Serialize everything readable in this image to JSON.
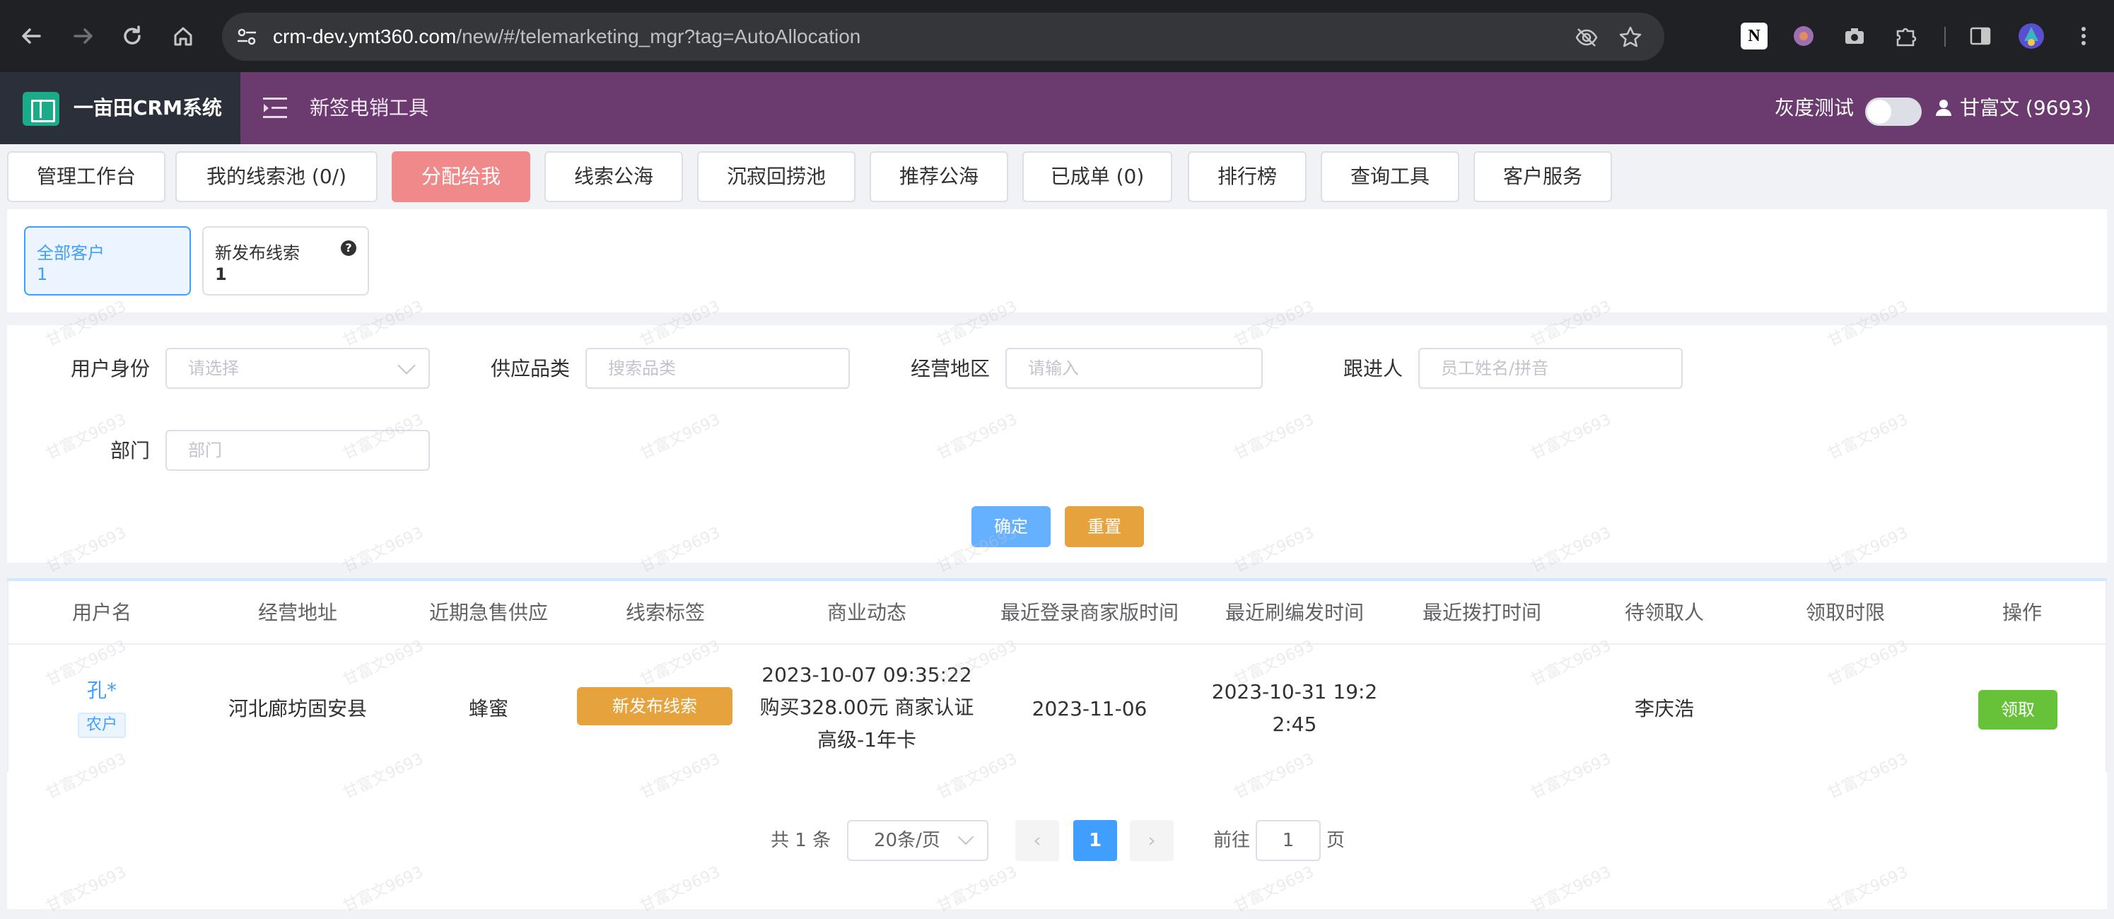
{
  "browser": {
    "url_host": "crm-dev.ymt360.com",
    "url_path": "/new/#/telemarketing_mgr?tag=AutoAllocation",
    "icons": [
      "back-icon",
      "forward-icon",
      "reload-icon",
      "home-icon",
      "site-settings-icon",
      "eye-off-icon",
      "star-icon",
      "notion-icon",
      "extension-icon",
      "camera-icon",
      "puzzle-icon",
      "side-panel-icon",
      "profile-icon",
      "more-icon"
    ]
  },
  "header": {
    "brand": "一亩田CRM系统",
    "tool_title": "新签电销工具",
    "gray_test_label": "灰度测试",
    "gray_test_on": false,
    "user": "甘富文 (9693)",
    "bg_color": "#6b3a6e"
  },
  "tabs": [
    {
      "label": "管理工作台"
    },
    {
      "label": "我的线索池 (0/)"
    },
    {
      "label": "分配给我"
    },
    {
      "label": "线索公海"
    },
    {
      "label": "沉寂回捞池"
    },
    {
      "label": "推荐公海"
    },
    {
      "label": "已成单 (0)"
    },
    {
      "label": "排行榜"
    },
    {
      "label": "查询工具"
    },
    {
      "label": "客户服务"
    }
  ],
  "active_tab": "分配给我",
  "cards": [
    {
      "title": "全部客户",
      "count": "1",
      "active": true
    },
    {
      "title": "新发布线索",
      "count": "1",
      "active": false
    }
  ],
  "filter": {
    "identity_label": "用户身份",
    "identity_placeholder": "请选择",
    "category_label": "供应品类",
    "category_placeholder": "搜索品类",
    "region_label": "经营地区",
    "region_placeholder": "请输入",
    "follower_label": "跟进人",
    "follower_placeholder": "员工姓名/拼音",
    "dept_label": "部门",
    "dept_placeholder": "部门",
    "confirm": "确定",
    "reset": "重置"
  },
  "table": {
    "columns": [
      "用户名",
      "经营地址",
      "近期急售供应",
      "线索标签",
      "商业动态",
      "最近登录商家版时间",
      "最近刷编发时间",
      "最近拨打时间",
      "待领取人",
      "领取时限",
      "操作"
    ],
    "rows": [
      {
        "username": "孔*",
        "user_tag": "农户",
        "address": "河北廊坊固安县",
        "supply": "蜂蜜",
        "lead_tag": "新发布线索",
        "biz_line1": "2023-10-07 09:35:22",
        "biz_line2": "购买328.00元 商家认证",
        "biz_line3": "高级-1年卡",
        "last_login": "2023-11-06",
        "last_refresh_line1": "2023-10-31 19:2",
        "last_refresh_line2": "2:45",
        "last_call": "",
        "claimer": "李庆浩",
        "deadline": "",
        "action": "领取"
      }
    ]
  },
  "pagination": {
    "total": "共 1 条",
    "page_size": "20条/页",
    "current_page": "1",
    "goto_label": "前往",
    "goto_value": "1",
    "page_suffix": "页",
    "prev": "‹",
    "next": "›"
  },
  "watermark": "甘富文9693",
  "colors": {
    "primary": "#409eff",
    "warning": "#e6a23c",
    "success": "#67c23a",
    "active_tab": "#f08a8a"
  }
}
